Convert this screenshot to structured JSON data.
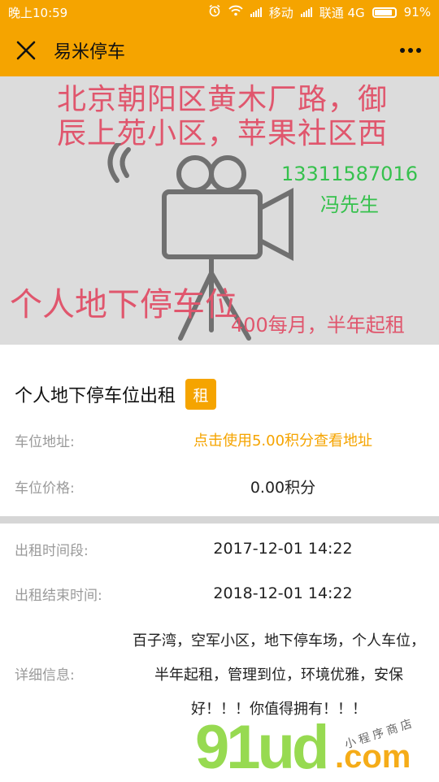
{
  "status": {
    "time": "晚上10:59",
    "carrier1": "移动",
    "carrier2": "联通 4G",
    "battery": "91%",
    "battery_level": 0.91
  },
  "nav": {
    "title": "易米停车"
  },
  "banner": {
    "address": "北京朝阳区黄木厂路，御辰上苑小区，苹果社区西",
    "phone": "13311587016",
    "contact": "冯先生",
    "slogan": "个人地下停车位",
    "price_note": "400每月，半年起租"
  },
  "listing": {
    "title": "个人地下停车位出租",
    "badge": "租",
    "address_label": "车位地址:",
    "address_value": "点击使用5.00积分查看地址",
    "price_label": "车位价格:",
    "price_value": "0.00积分",
    "period_label": "出租时间段:",
    "period_value": "2017-12-01 14:22",
    "end_label": "出租结束时间:",
    "end_value": "2018-12-01 14:22",
    "detail_label": "详细信息:",
    "detail_value": "百子湾，空军小区，地下停车场，个人车位，半年起租，管理到位，环境优雅，安保好！！！你值得拥有！！！"
  },
  "watermark": {
    "brand": "91ud",
    "domain": ".com",
    "tagline": "小程序商店"
  },
  "colors": {
    "accent": "#f5a400",
    "banner_bg": "#dcdcdc",
    "banner_red": "#e0566d",
    "banner_green": "#36c14d"
  }
}
